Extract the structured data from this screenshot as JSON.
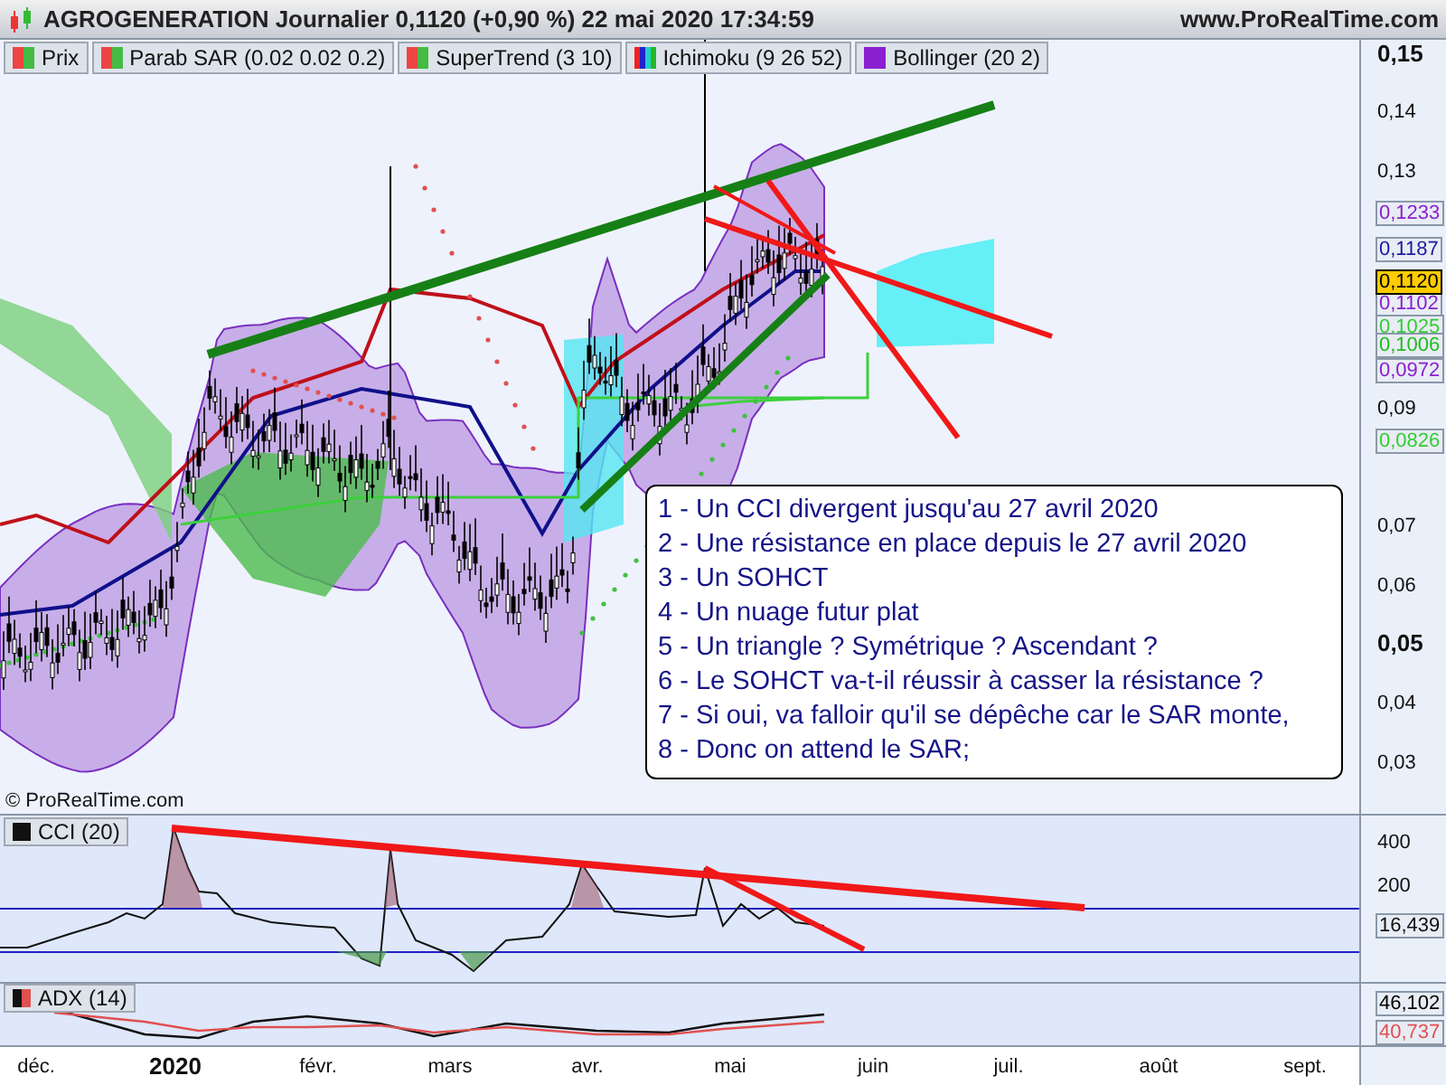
{
  "header": {
    "title": "AGROGENERATION Journalier 0,1120 (+0,90 %) 22 mai 2020 17:34:59",
    "site": "www.ProRealTime.com"
  },
  "legend": [
    {
      "label": "Prix",
      "kind": "twotone"
    },
    {
      "label": "Parab SAR (0.02 0.02 0.2)",
      "kind": "twotone"
    },
    {
      "label": "SuperTrend (3 10)",
      "kind": "twotone"
    },
    {
      "label": "Ichimoku (9 26 52)",
      "kind": "spectrum"
    },
    {
      "label": "Bollinger (20 2)",
      "kind": "solid"
    }
  ],
  "price_axis": {
    "ticks": [
      {
        "label": "0,15",
        "major": true
      },
      {
        "label": "0,14",
        "major": false
      },
      {
        "label": "0,13",
        "major": false
      },
      {
        "label": "0,09",
        "major": false
      },
      {
        "label": "0,07",
        "major": false
      },
      {
        "label": "0,06",
        "major": false
      },
      {
        "label": "0,05",
        "major": true
      },
      {
        "label": "0,04",
        "major": false
      },
      {
        "label": "0,03",
        "major": false
      }
    ],
    "markers": [
      {
        "label": "0,1233",
        "color": "#8a1fd0",
        "kind": "outline"
      },
      {
        "label": "0,1187",
        "color": "#1a1aa0",
        "kind": "outline"
      },
      {
        "label": "0,1120",
        "color": "#000000",
        "kind": "filled"
      },
      {
        "label": "0,1102",
        "color": "#8a1fd0",
        "kind": "outline"
      },
      {
        "label": "0,1025",
        "color": "#33cc33",
        "kind": "outline"
      },
      {
        "label": "0,1006",
        "color": "#22bb22",
        "kind": "outline"
      },
      {
        "label": "0,0972",
        "color": "#8a1fd0",
        "kind": "outline"
      },
      {
        "label": "0,0826",
        "color": "#33cc33",
        "kind": "outline"
      }
    ]
  },
  "annotation": {
    "lines": [
      "1 - Un CCI divergent jusqu'au 27 avril 2020",
      "2 - Une résistance en place depuis le 27 avril  2020",
      "3 - Un SOHCT",
      "4 - Un nuage futur plat",
      "5 - Un triangle ? Symétrique ? Ascendant ?",
      "6 - Le SOHCT va-t-il réussir à casser la résistance ?",
      "7 - Si oui, va falloir qu'il se dépêche car le SAR monte,",
      "8 - Donc on attend le SAR;"
    ]
  },
  "copyright": "© ProRealTime.com",
  "cci": {
    "label": "CCI (20)",
    "ticks": [
      "400",
      "200"
    ],
    "marker": "16,439"
  },
  "adx": {
    "label": "ADX (14)",
    "markers": [
      {
        "label": "46,102",
        "color": "#000000"
      },
      {
        "label": "40,737",
        "color": "#e05050"
      }
    ]
  },
  "time_axis": [
    {
      "label": "déc.",
      "major": false
    },
    {
      "label": "2020",
      "major": true
    },
    {
      "label": "févr.",
      "major": false
    },
    {
      "label": "mars",
      "major": false
    },
    {
      "label": "avr.",
      "major": false
    },
    {
      "label": "mai",
      "major": false
    },
    {
      "label": "juin",
      "major": false
    },
    {
      "label": "juil.",
      "major": false
    },
    {
      "label": "août",
      "major": false
    },
    {
      "label": "sept.",
      "major": false
    }
  ]
}
